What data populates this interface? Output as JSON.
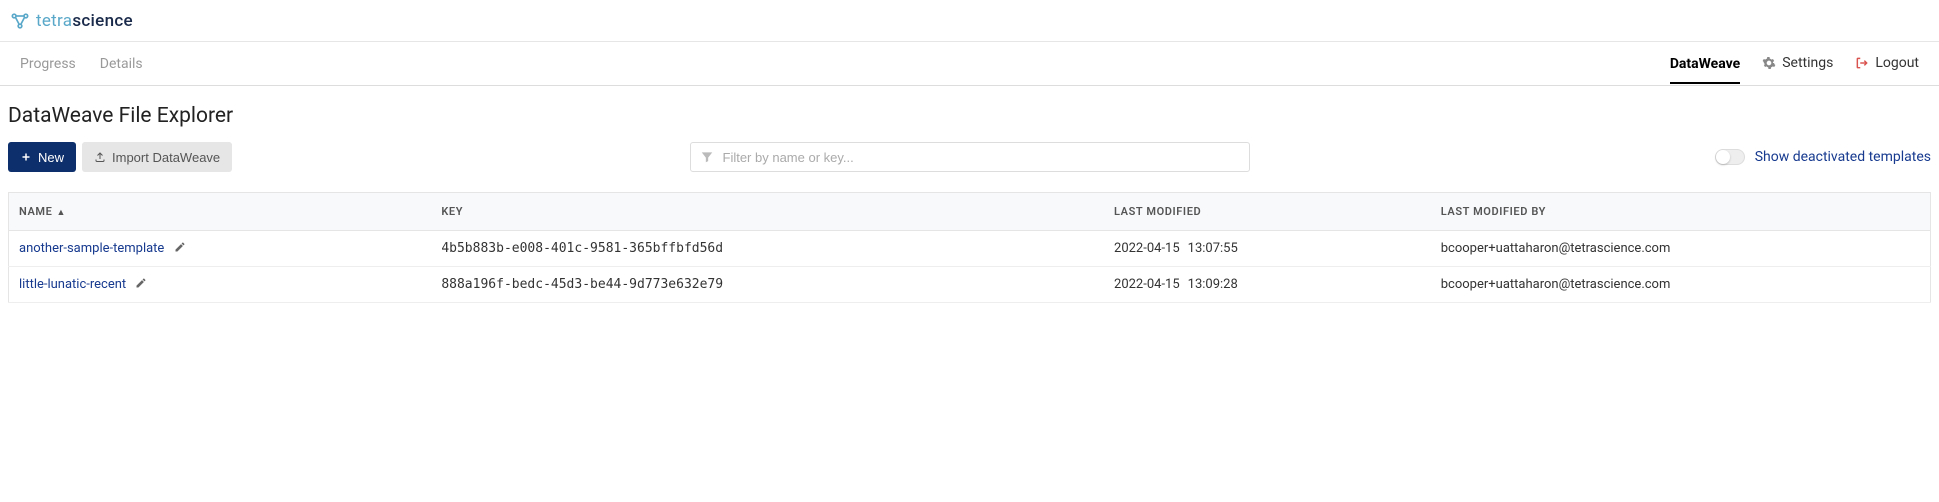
{
  "brand": {
    "part1": "tetra",
    "part2": "science"
  },
  "nav": {
    "left": [
      "Progress",
      "Details"
    ],
    "right": {
      "dataweave": "DataWeave",
      "settings": "Settings",
      "logout": "Logout"
    }
  },
  "page": {
    "title": "DataWeave File Explorer"
  },
  "toolbar": {
    "new_label": "New",
    "import_label": "Import DataWeave",
    "filter_placeholder": "Filter by name or key...",
    "toggle_label": "Show deactivated templates"
  },
  "table": {
    "headers": {
      "name": "NAME",
      "key": "KEY",
      "last_modified": "LAST MODIFIED",
      "last_modified_by": "LAST MODIFIED BY"
    },
    "rows": [
      {
        "name": "another-sample-template",
        "key": "4b5b883b-e008-401c-9581-365bffbfd56d",
        "date": "2022-04-15",
        "time": "13:07:55",
        "by": "bcooper+uattaharon@tetrascience.com"
      },
      {
        "name": "little-lunatic-recent",
        "key": "888a196f-bedc-45d3-be44-9d773e632e79",
        "date": "2022-04-15",
        "time": "13:09:28",
        "by": "bcooper+uattaharon@tetrascience.com"
      }
    ]
  }
}
